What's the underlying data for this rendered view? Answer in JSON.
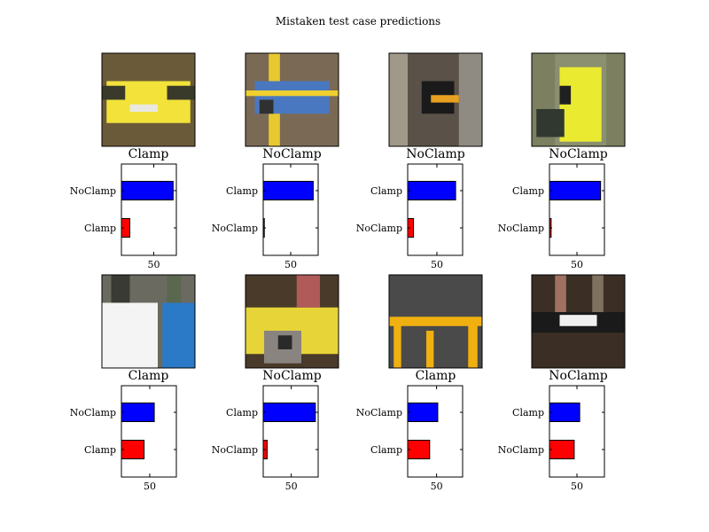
{
  "title": "Mistaken test case predictions",
  "colors": {
    "top_bar": "#0000ff",
    "bottom_bar": "#ff0000",
    "axis": "#000000"
  },
  "chart_data": [
    {
      "type": "bar",
      "orientation": "horizontal",
      "label": "Clamp",
      "image": "yellow-pipe-clamp-photo",
      "categories": [
        "Clamp",
        "NoClamp"
      ],
      "values": [
        13,
        80
      ],
      "xticks": [
        50
      ],
      "xlim": [
        0,
        85
      ]
    },
    {
      "type": "bar",
      "orientation": "horizontal",
      "label": "NoClamp",
      "image": "blue-bag-pipe-photo",
      "categories": [
        "NoClamp",
        "Clamp"
      ],
      "values": [
        2,
        91
      ],
      "xticks": [
        50
      ],
      "xlim": [
        0,
        100
      ]
    },
    {
      "type": "bar",
      "orientation": "horizontal",
      "label": "NoClamp",
      "image": "pipe-in-hole-photo",
      "categories": [
        "NoClamp",
        "Clamp"
      ],
      "values": [
        10,
        82
      ],
      "xticks": [
        50
      ],
      "xlim": [
        0,
        94
      ]
    },
    {
      "type": "bar",
      "orientation": "horizontal",
      "label": "NoClamp",
      "image": "yellow-tool-photo",
      "categories": [
        "NoClamp",
        "Clamp"
      ],
      "values": [
        3,
        93
      ],
      "xticks": [
        50
      ],
      "xlim": [
        0,
        100
      ]
    },
    {
      "type": "bar",
      "orientation": "horizontal",
      "label": "Clamp",
      "image": "valve-pipe-photo",
      "categories": [
        "Clamp",
        "NoClamp"
      ],
      "values": [
        40,
        58
      ],
      "xticks": [
        50
      ],
      "xlim": [
        0,
        97
      ]
    },
    {
      "type": "bar",
      "orientation": "horizontal",
      "label": "NoClamp",
      "image": "yellow-clamp-closeup-photo",
      "categories": [
        "NoClamp",
        "Clamp"
      ],
      "values": [
        7,
        93
      ],
      "xticks": [
        50
      ],
      "xlim": [
        0,
        98
      ]
    },
    {
      "type": "bar",
      "orientation": "horizontal",
      "label": "Clamp",
      "image": "yellow-frame-gravel-photo",
      "categories": [
        "Clamp",
        "NoClamp"
      ],
      "values": [
        38,
        52
      ],
      "xticks": [
        50
      ],
      "xlim": [
        0,
        95
      ]
    },
    {
      "type": "bar",
      "orientation": "horizontal",
      "label": "NoClamp",
      "image": "black-pipe-label-photo",
      "categories": [
        "NoClamp",
        "Clamp"
      ],
      "values": [
        45,
        55
      ],
      "xticks": [
        50
      ],
      "xlim": [
        0,
        100
      ]
    }
  ]
}
